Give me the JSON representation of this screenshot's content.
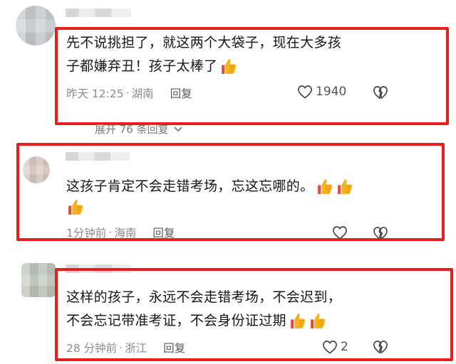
{
  "comments": [
    {
      "lines": [
        "先不说挑担了，就这两个大袋子，现在大多孩",
        "子都嫌弃丑！孩子太棒了"
      ],
      "time": "昨天 12:25",
      "location": "湖南",
      "reply_label": "回复",
      "like_count": "1940"
    },
    {
      "lines": [
        "这孩子肯定不会走错考场，忘这忘哪的。",
        ""
      ],
      "time": "1分钟前",
      "location": "海南",
      "reply_label": "回复",
      "like_count": ""
    },
    {
      "lines": [
        "这样的孩子，永远不会走错考场，不会迟到，",
        "不会忘记带准考证，不会身份证过期"
      ],
      "time": "28 分钟前",
      "location": "浙江",
      "reply_label": "回复",
      "like_count": "2"
    }
  ],
  "expand_replies": "展开 76 条回复",
  "icons": {
    "emoji": "thumbs-up-emoji",
    "like": "heart-icon",
    "dislike": "broken-heart-icon",
    "expand": "chevron-down-icon"
  },
  "colors": {
    "highlight_frame": "#e61e1e",
    "emoji": "#f6b21b",
    "meta_text": "#8a8a8a"
  }
}
